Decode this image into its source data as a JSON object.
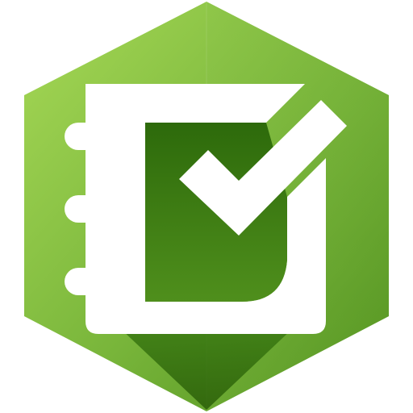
{
  "app_icon": {
    "icon_name": "survey-checklist-icon",
    "colors": {
      "hex_light": "#9fd04f",
      "hex_mid": "#69a82d",
      "hex_dark": "#3f7f12",
      "panel_dark": "#2f6a0c",
      "glyph_white": "#ffffff"
    }
  }
}
